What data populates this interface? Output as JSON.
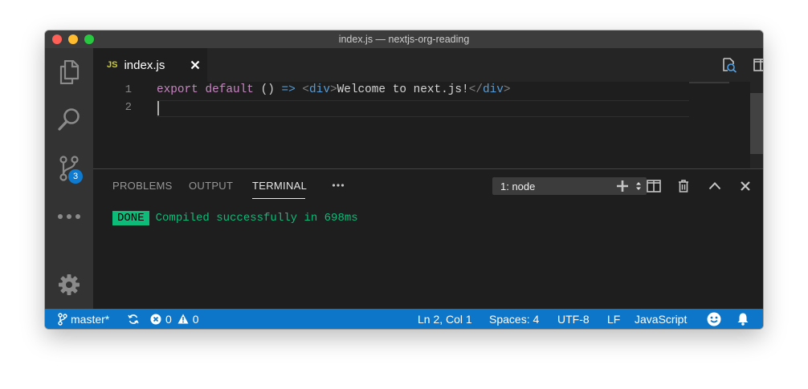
{
  "window": {
    "title": "index.js — nextjs-org-reading"
  },
  "activity_bar": {
    "items": [
      {
        "icon": "files-icon"
      },
      {
        "icon": "search-icon"
      },
      {
        "icon": "source-control-icon",
        "badge": "3"
      },
      {
        "icon": "more-icon"
      },
      {
        "icon": "gear-icon"
      }
    ]
  },
  "tabs": [
    {
      "lang_badge": "JS",
      "label": "index.js",
      "active": true
    }
  ],
  "editor": {
    "lines": [
      {
        "number": "1",
        "tokens": {
          "export": "export",
          "default": "default",
          "parens": "()",
          "arrow": "=>",
          "open_lt": "<",
          "open_tag": "div",
          "open_gt": ">",
          "text": "Welcome to next.js!",
          "close_lt": "</",
          "close_tag": "div",
          "close_gt": ">"
        }
      },
      {
        "number": "2"
      }
    ]
  },
  "panel": {
    "tabs": [
      "PROBLEMS",
      "OUTPUT",
      "TERMINAL"
    ],
    "active_tab": "TERMINAL",
    "terminal_selector": "1: node",
    "output": {
      "badge": "DONE",
      "message": "Compiled successfully in 698ms"
    }
  },
  "status_bar": {
    "branch": "master*",
    "errors": "0",
    "warnings": "0",
    "cursor": "Ln 2, Col 1",
    "indent": "Spaces: 4",
    "encoding": "UTF-8",
    "eol": "LF",
    "language": "JavaScript"
  },
  "colors": {
    "accent": "#0d76c9",
    "terminal_success": "#0dbc79",
    "keyword": "#c586c0",
    "tag": "#569cd6"
  }
}
